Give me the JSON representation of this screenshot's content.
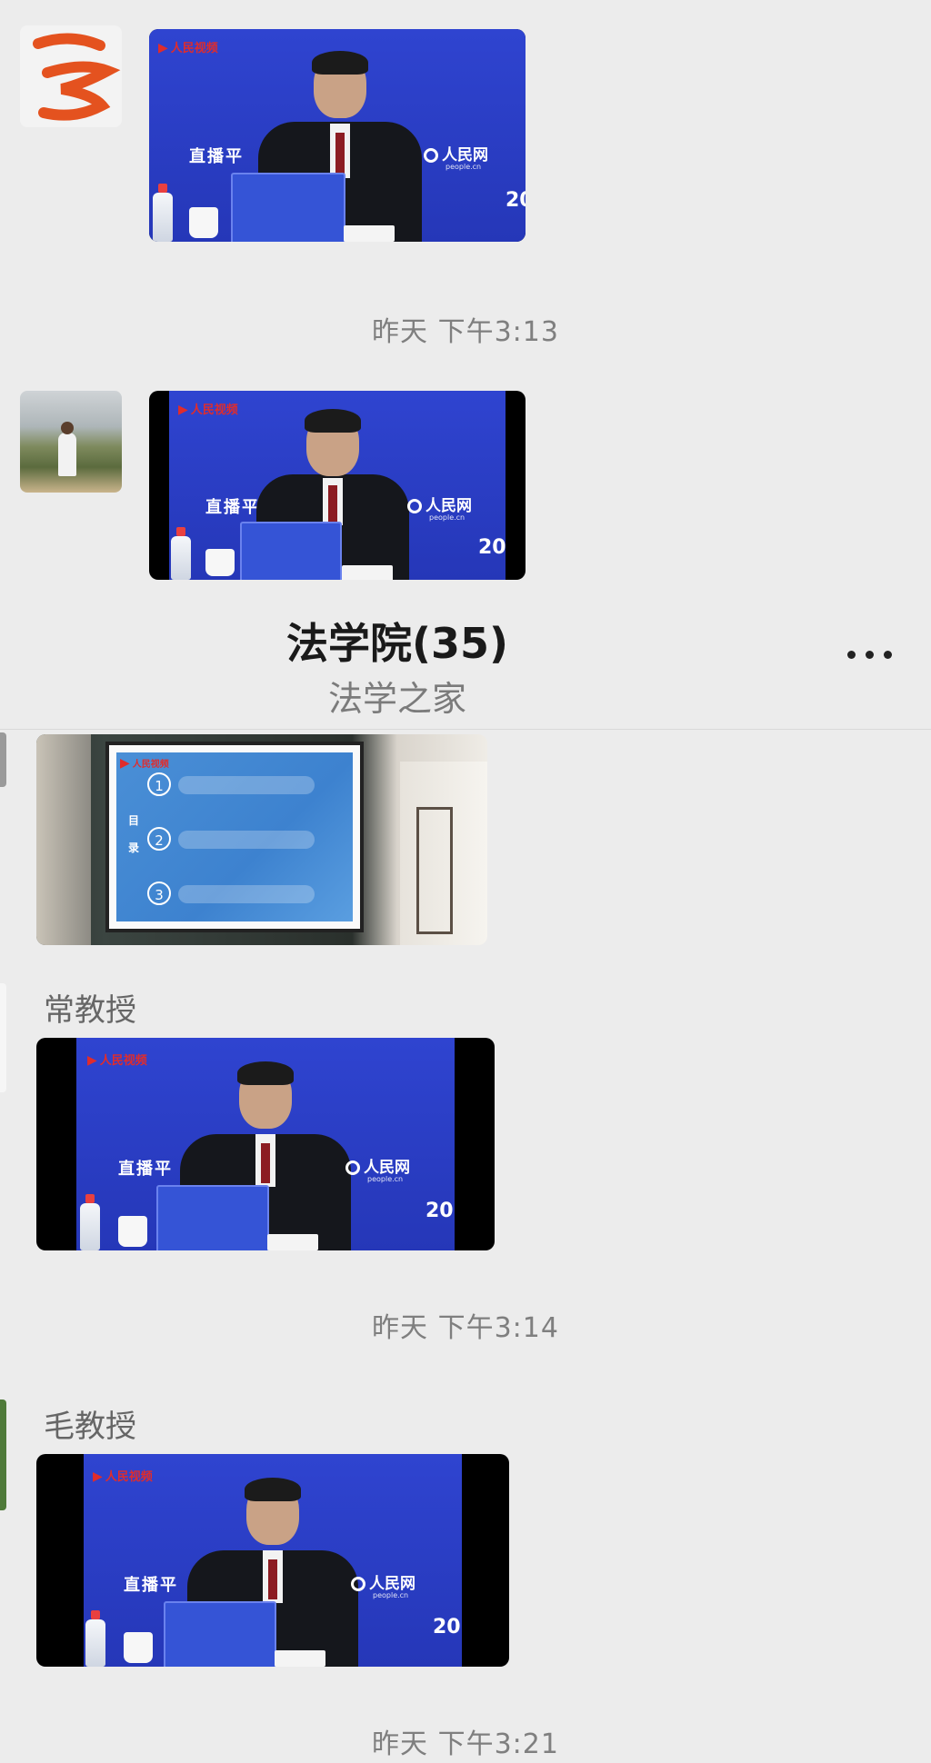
{
  "group": {
    "title": "法学院(35)",
    "subtitle": "法学之家"
  },
  "video_overlay": {
    "brand": "人民视频",
    "live_text": "直播平",
    "site_logo": "人民网",
    "site_domain": "people.cn",
    "year_fragment": "20"
  },
  "presentation": {
    "toc_title": "目录",
    "items": [
      "1",
      "2",
      "3"
    ]
  },
  "messages": [
    {
      "type": "video",
      "sender": "",
      "avatar": "orange-glyph-avatar"
    },
    {
      "type": "time",
      "text": "昨天 下午3:13"
    },
    {
      "type": "video",
      "sender": "",
      "avatar": "landscape-photo-avatar"
    },
    {
      "type": "image"
    },
    {
      "type": "video",
      "sender": "常教授"
    },
    {
      "type": "time",
      "text": "昨天 下午3:14"
    },
    {
      "type": "video",
      "sender": "毛教授"
    },
    {
      "type": "time",
      "text": "昨天 下午3:21"
    }
  ],
  "colors": {
    "background": "#ececec",
    "video_blue": "#2f44d0",
    "brand_red": "#e02c2c"
  }
}
